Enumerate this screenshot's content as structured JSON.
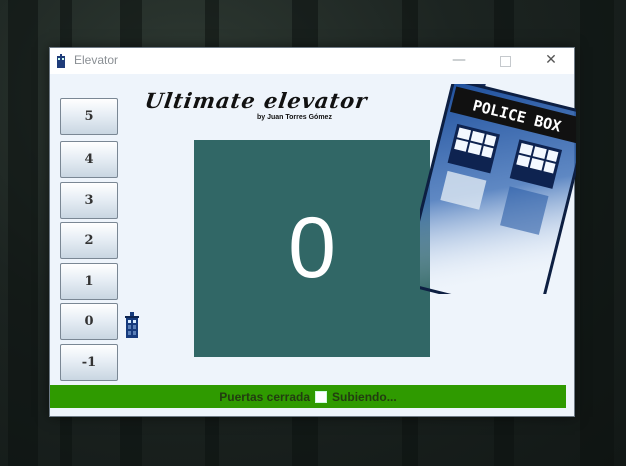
{
  "window": {
    "title": "Elevator"
  },
  "app": {
    "title": "Ultimate elevator",
    "subtitle": "by Juan Torres Gómez"
  },
  "floors": [
    "5",
    "4",
    "3",
    "2",
    "1",
    "0",
    "-1"
  ],
  "current_floor_indicator": "0",
  "display": {
    "value": "0",
    "color": "#316766"
  },
  "tardis_sign": "POLICE BOX",
  "status": {
    "doors": "Puertas cerrada",
    "movement": "Subiendo...",
    "color": "#2f9a00"
  }
}
